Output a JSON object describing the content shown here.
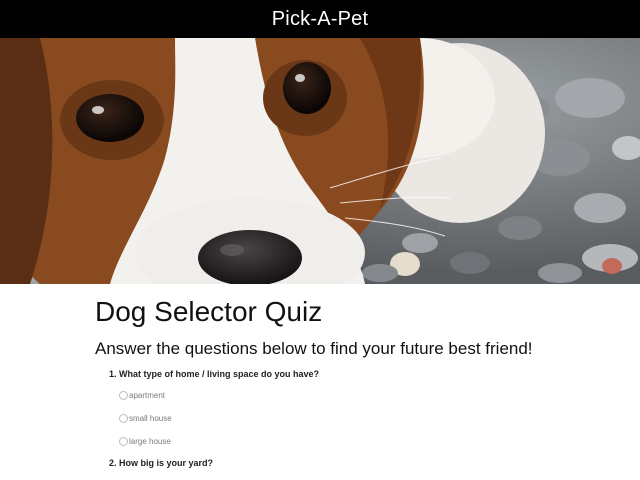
{
  "header": {
    "brand": "Pick-A-Pet"
  },
  "hero": {
    "image_icon": "beagle-puppy-photo"
  },
  "quiz": {
    "title": "Dog Selector Quiz",
    "subtitle": "Answer the questions below to find your future best friend!",
    "questions": [
      {
        "label": "1. What type of home / living space do you have?",
        "options": [
          "apartment",
          "small house",
          "large house"
        ]
      },
      {
        "label": "2. How big is your yard?"
      }
    ]
  },
  "colors": {
    "topbar": "#000000",
    "brand_text": "#ffffff",
    "option_text": "#7a7a7a"
  }
}
